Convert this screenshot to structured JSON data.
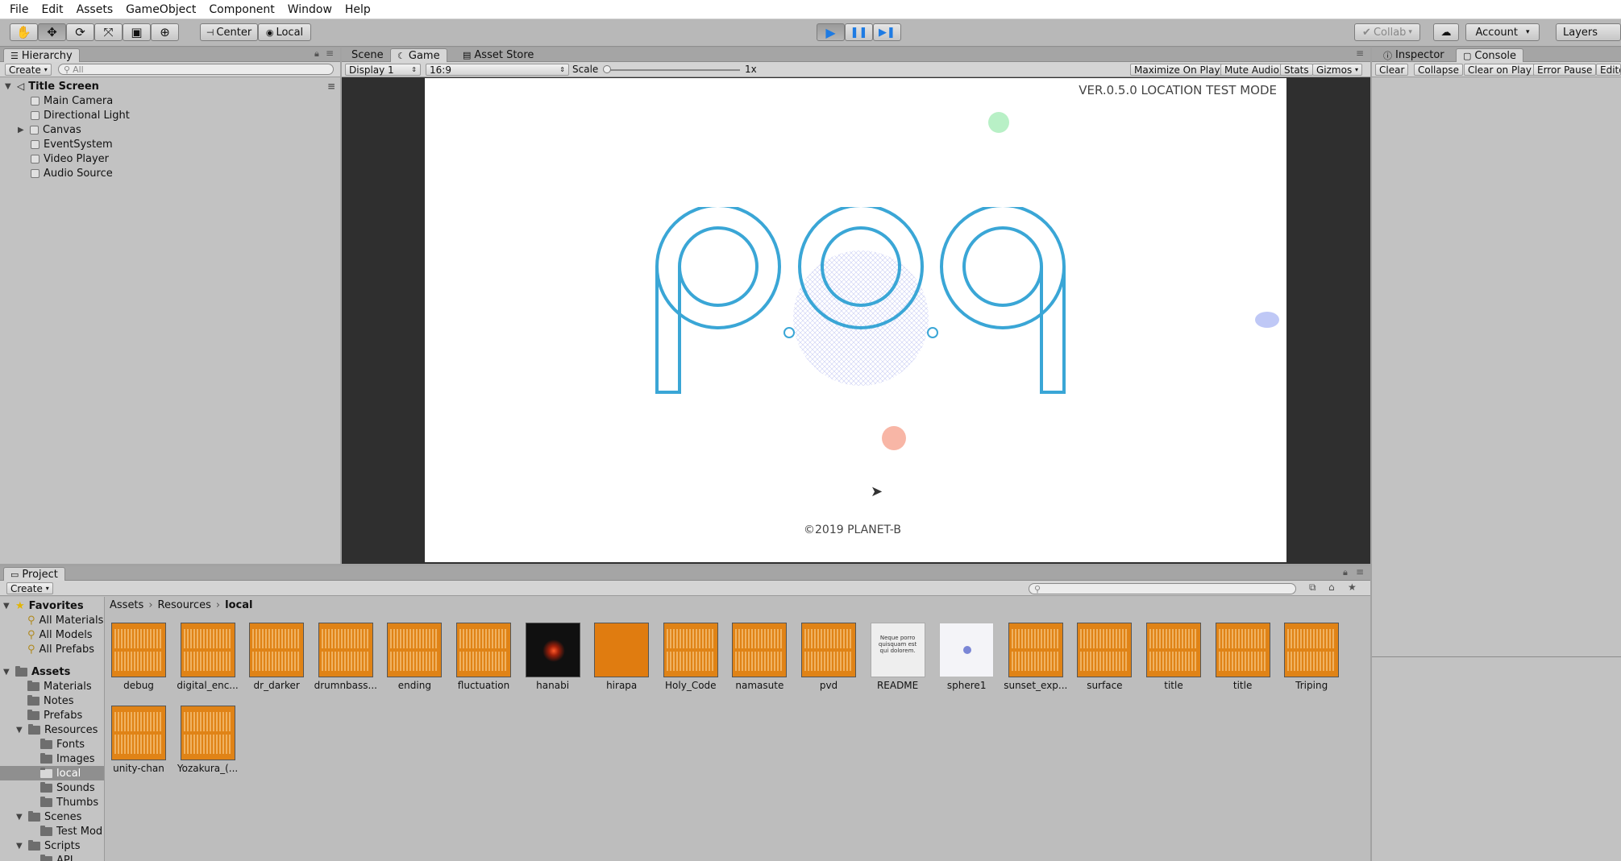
{
  "menu": [
    "File",
    "Edit",
    "Assets",
    "GameObject",
    "Component",
    "Window",
    "Help"
  ],
  "toolbar": {
    "tools": [
      "hand-tool-icon",
      "move-tool-icon",
      "rotate-tool-icon",
      "scale-tool-icon",
      "rect-tool-icon",
      "transform-tool-icon"
    ],
    "pivot_label": "Center",
    "space_label": "Local",
    "collab_label": "Collab",
    "account_label": "Account",
    "layers_label": "Layers"
  },
  "hierarchy": {
    "tab_label": "Hierarchy",
    "create_label": "Create",
    "search_placeholder": "All",
    "scene_name": "Title Screen",
    "objects": [
      "Main Camera",
      "Directional Light",
      "Canvas",
      "EventSystem",
      "Video Player",
      "Audio Source"
    ]
  },
  "center": {
    "tabs": [
      "Scene",
      "Game",
      "Asset Store"
    ],
    "active_tab": "Game",
    "display": "Display 1",
    "aspect": "16:9",
    "scale_label": "Scale",
    "scale_value": "1x",
    "buttons": [
      "Maximize On Play",
      "Mute Audio",
      "Stats",
      "Gizmos"
    ]
  },
  "game": {
    "version_text": "VER.0.5.0 LOCATION TEST MODE",
    "copyright_text": "©2019 PLANET-B",
    "logo_color": "#3aa6d6"
  },
  "right": {
    "tabs": [
      "Inspector",
      "Console"
    ],
    "active_tab": "Console",
    "console_buttons": [
      "Clear",
      "Collapse",
      "Clear on Play",
      "Error Pause",
      "Edito"
    ]
  },
  "project": {
    "tab_label": "Project",
    "create_label": "Create",
    "favorites_label": "Favorites",
    "favorites": [
      "All Materials",
      "All Models",
      "All Prefabs"
    ],
    "assets_label": "Assets",
    "tree": [
      {
        "label": "Materials",
        "level": 1
      },
      {
        "label": "Notes",
        "level": 1
      },
      {
        "label": "Prefabs",
        "level": 1
      },
      {
        "label": "Resources",
        "level": 1,
        "open": true
      },
      {
        "label": "Fonts",
        "level": 2
      },
      {
        "label": "Images",
        "level": 2
      },
      {
        "label": "local",
        "level": 2,
        "selected": true
      },
      {
        "label": "Sounds",
        "level": 2
      },
      {
        "label": "Thumbs",
        "level": 2
      },
      {
        "label": "Scenes",
        "level": 1,
        "open": true
      },
      {
        "label": "Test Mod",
        "level": 2
      },
      {
        "label": "Scripts",
        "level": 1,
        "open": true
      },
      {
        "label": "API",
        "level": 2
      }
    ],
    "breadcrumb": [
      "Assets",
      "Resources",
      "local"
    ],
    "items": [
      {
        "label": "debug",
        "kind": "wave"
      },
      {
        "label": "digital_enc...",
        "kind": "wave"
      },
      {
        "label": "dr_darker",
        "kind": "wave"
      },
      {
        "label": "drumnbass...",
        "kind": "wave"
      },
      {
        "label": "ending",
        "kind": "wave"
      },
      {
        "label": "fluctuation",
        "kind": "wave"
      },
      {
        "label": "hanabi",
        "kind": "dark"
      },
      {
        "label": "hirapa",
        "kind": "solid"
      },
      {
        "label": "Holy_Code",
        "kind": "wave"
      },
      {
        "label": "namasute",
        "kind": "wave"
      },
      {
        "label": "pvd",
        "kind": "wave"
      },
      {
        "label": "README",
        "kind": "doc"
      },
      {
        "label": "sphere1",
        "kind": "sph"
      },
      {
        "label": "sunset_exp...",
        "kind": "wave"
      },
      {
        "label": "surface",
        "kind": "wave"
      },
      {
        "label": "title",
        "kind": "wave"
      },
      {
        "label": "title",
        "kind": "wave"
      },
      {
        "label": "Triping",
        "kind": "wave"
      },
      {
        "label": "unity-chan",
        "kind": "wave"
      },
      {
        "label": "Yozakura_(...",
        "kind": "wave"
      }
    ],
    "readme_text": "Neque porro quisquam est qui dolorem."
  }
}
